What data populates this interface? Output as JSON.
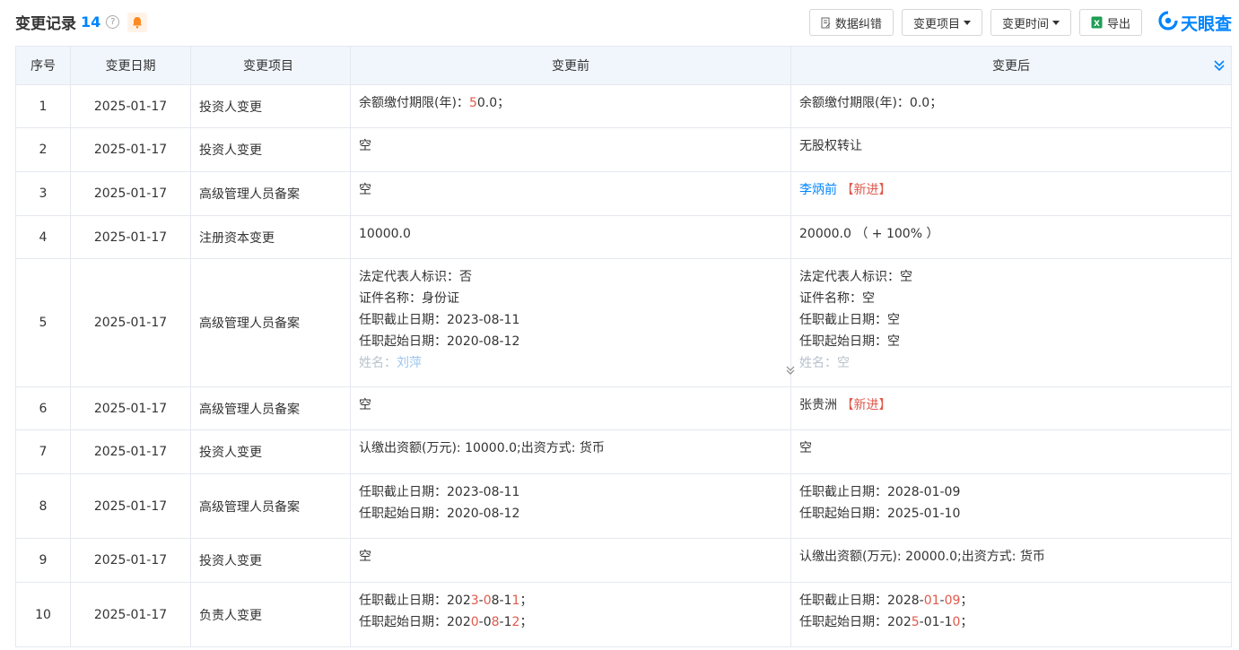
{
  "header": {
    "title": "变更记录",
    "count": "14",
    "help_icon": "?",
    "buttons": {
      "correction": "数据纠错",
      "change_item": "变更项目",
      "change_time": "变更时间",
      "export": "导出"
    },
    "logo_text": "天眼查"
  },
  "columns": [
    "序号",
    "变更日期",
    "变更项目",
    "变更前",
    "变更后"
  ],
  "rows": [
    {
      "idx": "1",
      "date": "2025-01-17",
      "item": "投资人变更"
    },
    {
      "idx": "2",
      "date": "2025-01-17",
      "item": "投资人变更"
    },
    {
      "idx": "3",
      "date": "2025-01-17",
      "item": "高级管理人员备案"
    },
    {
      "idx": "4",
      "date": "2025-01-17",
      "item": "注册资本变更"
    },
    {
      "idx": "5",
      "date": "2025-01-17",
      "item": "高级管理人员备案"
    },
    {
      "idx": "6",
      "date": "2025-01-17",
      "item": "高级管理人员备案"
    },
    {
      "idx": "7",
      "date": "2025-01-17",
      "item": "投资人变更"
    },
    {
      "idx": "8",
      "date": "2025-01-17",
      "item": "高级管理人员备案"
    },
    {
      "idx": "9",
      "date": "2025-01-17",
      "item": "投资人变更"
    },
    {
      "idx": "10",
      "date": "2025-01-17",
      "item": "负责人变更"
    }
  ],
  "text": {
    "r1_before_a": "余额缴付期限(年)：",
    "r1_before_b": "5",
    "r1_before_c": "0.0；",
    "r1_after": "余额缴付期限(年)：0.0；",
    "r2_before": "空",
    "r2_after": "无股权转让",
    "r3_before": "空",
    "r3_after_name": "李炳前",
    "r3_after_tag": "【新进】",
    "r4_before": "10000.0",
    "r4_after": "20000.0 （ + 100% ）",
    "r5_before": [
      "法定代表人标识：否",
      "证件名称：身份证",
      "任职截止日期：2023-08-11",
      "任职起始日期：2020-08-12"
    ],
    "r5_before_name_label": "姓名：",
    "r5_before_name": "刘萍",
    "r5_after": [
      "法定代表人标识：空",
      "证件名称：空",
      "任职截止日期：空",
      "任职起始日期：空"
    ],
    "r5_after_name": "姓名：空",
    "r6_before": "空",
    "r6_after_name": "张贵洲",
    "r6_after_tag": "【新进】",
    "r7_before": "认缴出资额(万元): 10000.0;出资方式: 货币",
    "r7_after": "空",
    "r8_before": [
      "任职截止日期：2023-08-11",
      "任职起始日期：2020-08-12"
    ],
    "r8_after": [
      "任职截止日期：2028-01-09",
      "任职起始日期：2025-01-10"
    ],
    "r9_before": "空",
    "r9_after": "认缴出资额(万元): 20000.0;出资方式: 货币",
    "r10_before_1": [
      "任职截止日期：202",
      "3",
      "-",
      "0",
      "8-1",
      "1",
      "；"
    ],
    "r10_before_2": [
      "任职起始日期：202",
      "0",
      "-0",
      "8",
      "-1",
      "2",
      "；"
    ],
    "r10_after_1": [
      "任职截止日期：2028-",
      "01",
      "-",
      "09",
      "；"
    ],
    "r10_after_2": [
      "任职起始日期：202",
      "5",
      "-01-1",
      "0",
      "；"
    ]
  },
  "colors": {
    "accent": "#0084ff",
    "highlight": "#e0594b",
    "header_bg": "#f1f6fc"
  }
}
